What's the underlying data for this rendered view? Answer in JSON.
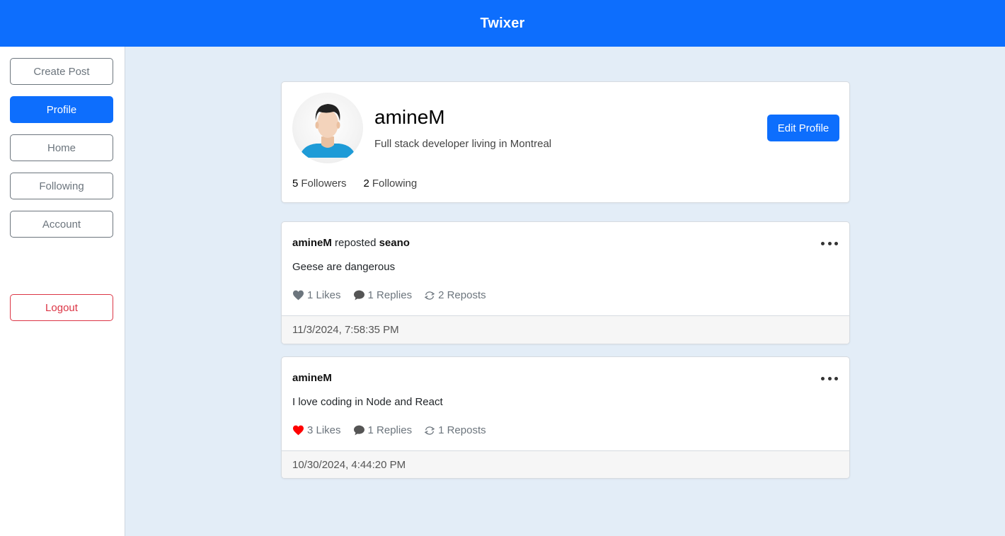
{
  "app": {
    "title": "Twixer"
  },
  "sidebar": {
    "items": [
      {
        "label": "Create Post"
      },
      {
        "label": "Profile"
      },
      {
        "label": "Home"
      },
      {
        "label": "Following"
      },
      {
        "label": "Account"
      }
    ],
    "logout_label": "Logout",
    "active_item": "Profile"
  },
  "profile": {
    "username": "amineM",
    "bio": "Full stack developer living in Montreal",
    "edit_label": "Edit Profile",
    "followers_count": "5",
    "followers_label": "Followers",
    "following_count": "2",
    "following_label": "Following"
  },
  "posts": [
    {
      "author": "amineM",
      "repost_verb": "reposted",
      "repost_of": "seano",
      "text": "Geese are dangerous",
      "likes": "1 Likes",
      "liked": false,
      "replies": "1 Replies",
      "reposts": "2 Reposts",
      "timestamp": "11/3/2024, 7:58:35 PM"
    },
    {
      "author": "amineM",
      "text": "I love coding in Node and React",
      "likes": "3 Likes",
      "liked": true,
      "replies": "1 Replies",
      "reposts": "1 Reposts",
      "timestamp": "10/30/2024, 4:44:20 PM"
    }
  ],
  "colors": {
    "primary": "#0d6efd",
    "danger": "#dc3545",
    "background": "#e3edf7",
    "liked_heart": "#ff0000",
    "unliked_heart": "#6c757d"
  }
}
